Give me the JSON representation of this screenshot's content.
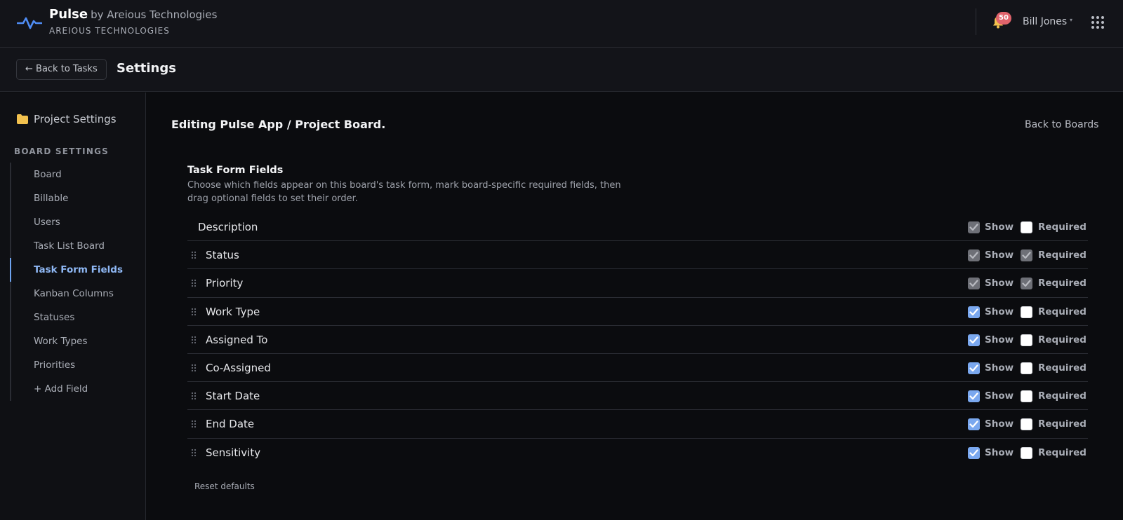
{
  "app": {
    "name": "Pulse",
    "by": "by Areious Technologies",
    "company": "AREIOUS TECHNOLOGIES",
    "notifications_count": "50",
    "user_name": "Bill Jones"
  },
  "subheader": {
    "back_label": "← Back to Tasks",
    "page_title": "Settings"
  },
  "sidebar": {
    "project_settings_label": "Project Settings",
    "board_settings_heading": "BOARD SETTINGS",
    "items": [
      {
        "label": "Board",
        "active": false
      },
      {
        "label": "Billable",
        "active": false
      },
      {
        "label": "Users",
        "active": false
      },
      {
        "label": "Task List Board",
        "active": false
      },
      {
        "label": "Task Form Fields",
        "active": true
      },
      {
        "label": "Kanban Columns",
        "active": false
      },
      {
        "label": "Statuses",
        "active": false
      },
      {
        "label": "Work Types",
        "active": false
      },
      {
        "label": "Priorities",
        "active": false
      },
      {
        "label": "+ Add Field",
        "active": false
      }
    ]
  },
  "main": {
    "editing_title": "Editing Pulse App / Project Board.",
    "back_to_boards": "Back to Boards",
    "section_title": "Task Form Fields",
    "section_description": "Choose which fields appear on this board's task form, mark board-specific required fields, then drag optional fields to set their order.",
    "show_label": "Show",
    "required_label": "Required",
    "fields": [
      {
        "label": "Description",
        "draggable": false,
        "show": "locked",
        "required": "off"
      },
      {
        "label": "Status",
        "draggable": true,
        "show": "locked",
        "required": "locked"
      },
      {
        "label": "Priority",
        "draggable": true,
        "show": "locked",
        "required": "locked"
      },
      {
        "label": "Work Type",
        "draggable": true,
        "show": "on",
        "required": "off"
      },
      {
        "label": "Assigned To",
        "draggable": true,
        "show": "on",
        "required": "off"
      },
      {
        "label": "Co-Assigned",
        "draggable": true,
        "show": "on",
        "required": "off"
      },
      {
        "label": "Start Date",
        "draggable": true,
        "show": "on",
        "required": "off"
      },
      {
        "label": "End Date",
        "draggable": true,
        "show": "on",
        "required": "off"
      },
      {
        "label": "Sensitivity",
        "draggable": true,
        "show": "on",
        "required": "off"
      }
    ],
    "reset_label": "Reset defaults"
  },
  "colors": {
    "accent": "#7aa8ef",
    "active_nav": "#8fb8f5",
    "badge": "#e0636b",
    "folder": "#f2c14e"
  }
}
